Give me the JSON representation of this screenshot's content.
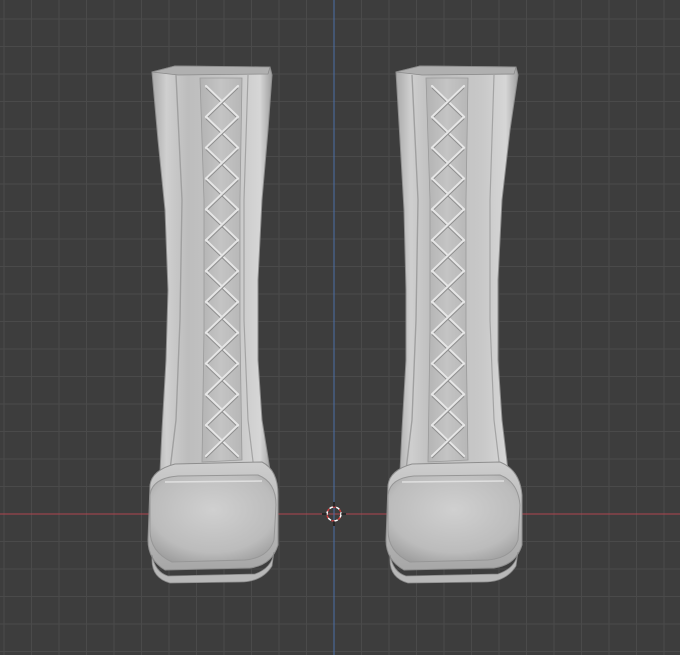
{
  "viewport": {
    "background_color": "#3d3d3d",
    "grid_line_color": "#4a4a4a",
    "grid_subline_color": "#444444",
    "x_axis_color": "#b0454e",
    "y_axis_color": "#4a6fa8",
    "origin_marker_color": "#ffffff"
  },
  "scene": {
    "objects": [
      {
        "name": "left-boot",
        "material_color": "#c9c9c9"
      },
      {
        "name": "right-boot",
        "material_color": "#c9c9c9"
      }
    ]
  }
}
